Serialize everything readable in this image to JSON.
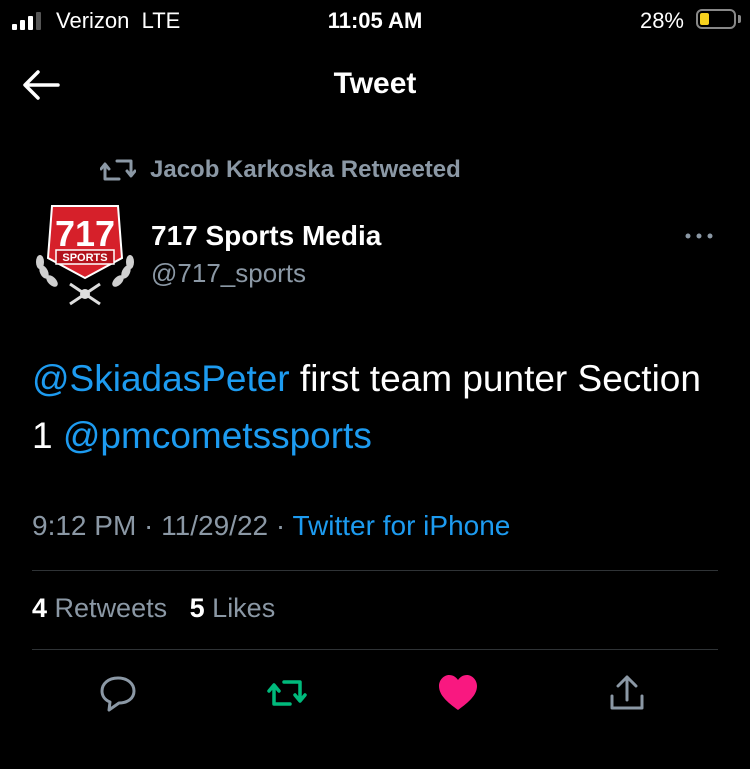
{
  "status_bar": {
    "carrier": "Verizon",
    "network": "LTE",
    "time": "11:05 AM",
    "battery_percent": "28%",
    "battery_level": 0.28,
    "signal_bars_active": 3,
    "signal_bars_total": 4
  },
  "header": {
    "title": "Tweet",
    "back_icon": "arrow-left-icon"
  },
  "retweet_context": {
    "text": "Jacob Karkoska Retweeted",
    "icon": "retweet-icon"
  },
  "author": {
    "name": "717 Sports Media",
    "handle": "@717_sports",
    "avatar_logo_text": "717",
    "avatar_banner_text": "SPORTS"
  },
  "tweet": {
    "mention1": "@SkiadasPeter",
    "text1": " first team punter Section 1 ",
    "mention2": "@pmcometssports",
    "time": "9:12 PM",
    "separator": " · ",
    "date": "11/29/22",
    "source": "Twitter for iPhone"
  },
  "stats": {
    "retweets_count": "4",
    "retweets_label": "Retweets",
    "likes_count": "5",
    "likes_label": "Likes"
  },
  "actions": [
    {
      "name": "reply",
      "icon": "reply-icon",
      "color": "#8b98a5"
    },
    {
      "name": "retweet",
      "icon": "retweet-icon",
      "color": "#00ba7c"
    },
    {
      "name": "like",
      "icon": "heart-icon",
      "color": "#f91880"
    },
    {
      "name": "share",
      "icon": "share-icon",
      "color": "#8b98a5"
    }
  ],
  "colors": {
    "background": "#000000",
    "accent_link": "#1d9bf0",
    "muted_text": "#8b98a5",
    "retweet_green": "#00ba7c",
    "like_pink": "#f91880",
    "battery_yellow": "#f7d21e"
  }
}
